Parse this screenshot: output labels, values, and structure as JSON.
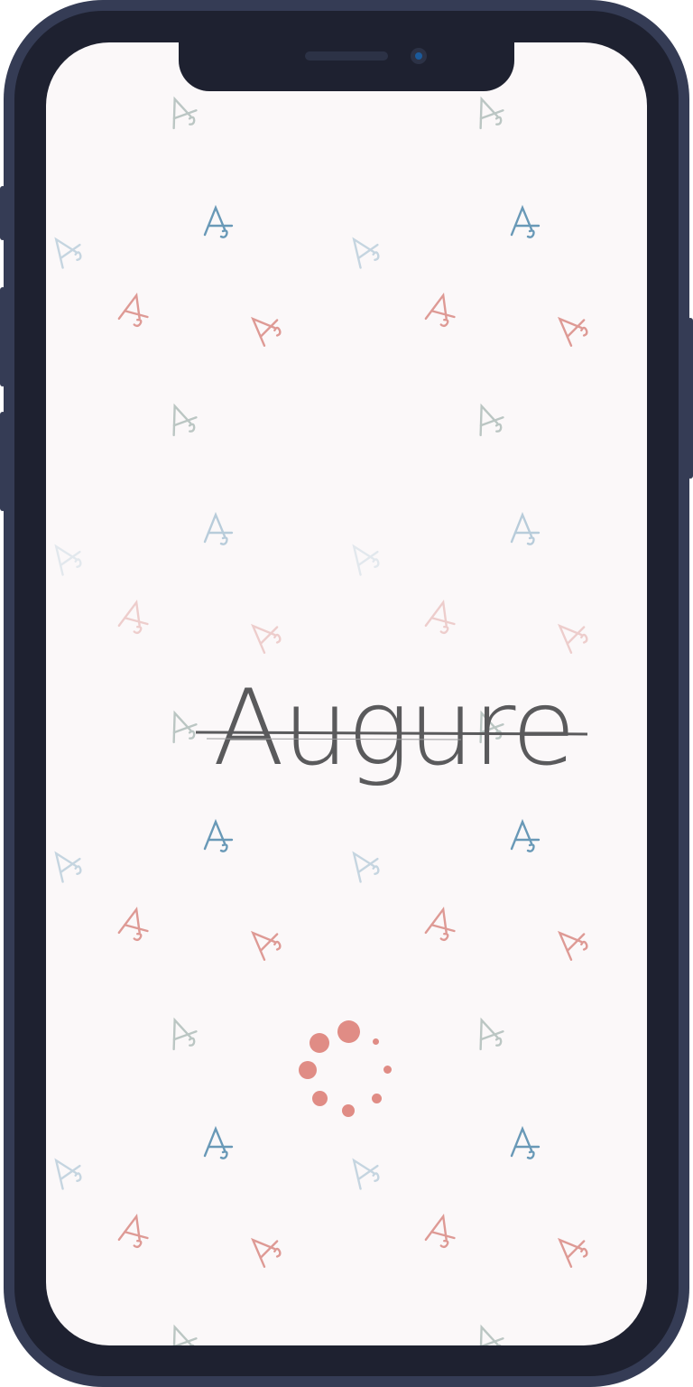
{
  "app": {
    "name": "Augure",
    "logo_text": "Augure"
  },
  "screen": {
    "state": "loading",
    "background_color": "#fbf8f9"
  },
  "colors": {
    "device_frame": "#353c55",
    "device_bezel": "#1e2130",
    "logo_text": "#5a5a5c",
    "spinner": "#e08c85",
    "pattern_blue": "#5a8fb0",
    "pattern_red": "#d98a84",
    "pattern_gray": "#a6b6b2"
  },
  "spinner": {
    "icon": "loading-spinner-icon"
  },
  "pattern": {
    "icon": "augure-monogram-icon"
  }
}
